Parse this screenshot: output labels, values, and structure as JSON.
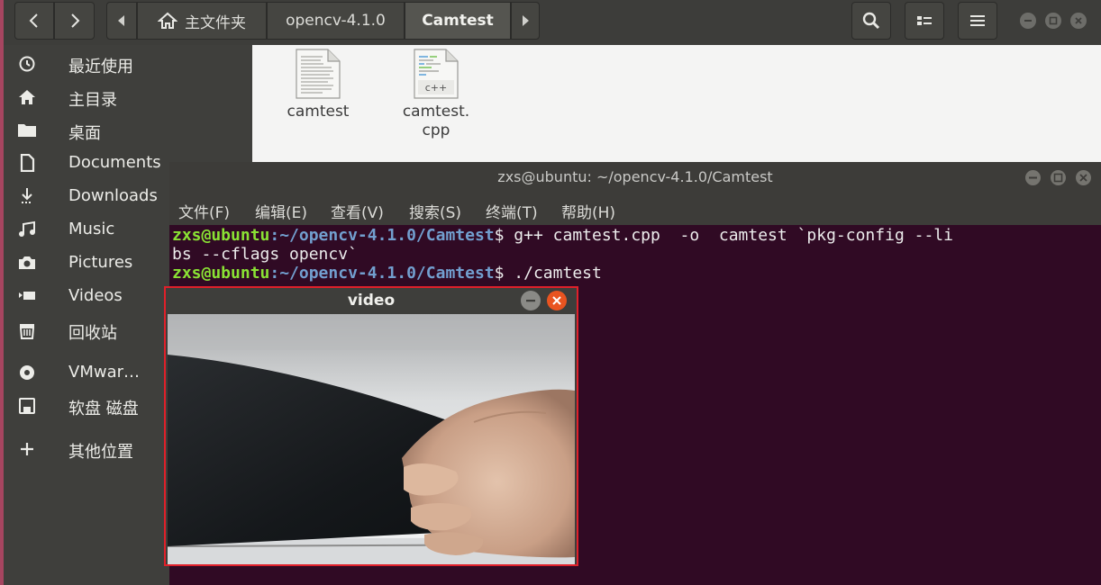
{
  "file_manager": {
    "breadcrumb": [
      "主文件夹",
      "opencv-4.1.0",
      "Camtest"
    ],
    "sidebar": [
      {
        "label": "最近使用",
        "icon": "clock-icon"
      },
      {
        "label": "主目录",
        "icon": "home-icon"
      },
      {
        "label": "桌面",
        "icon": "folder-icon"
      },
      {
        "label": "Documents",
        "icon": "document-icon"
      },
      {
        "label": "Downloads",
        "icon": "download-icon"
      },
      {
        "label": "Music",
        "icon": "music-icon"
      },
      {
        "label": "Pictures",
        "icon": "camera-icon"
      },
      {
        "label": "Videos",
        "icon": "video-icon"
      },
      {
        "label": "回收站",
        "icon": "trash-icon"
      },
      {
        "label": "VMwar…",
        "icon": "disc-icon"
      },
      {
        "label": "软盘 磁盘",
        "icon": "floppy-icon"
      },
      {
        "label": "其他位置",
        "icon": "plus-icon"
      }
    ],
    "files": [
      {
        "name": "camtest",
        "icon": "text-file-icon"
      },
      {
        "name": "camtest.\ncpp",
        "icon": "cpp-file-icon",
        "badge": "c++"
      }
    ]
  },
  "terminal": {
    "title": "zxs@ubuntu: ~/opencv-4.1.0/Camtest",
    "menu": [
      "文件(F)",
      "编辑(E)",
      "查看(V)",
      "搜索(S)",
      "终端(T)",
      "帮助(H)"
    ],
    "lines": [
      {
        "user": "zxs@ubuntu",
        "path": ":~/opencv-4.1.0/Camtest",
        "cmd": "$ g++ camtest.cpp  -o  camtest `pkg-config --li"
      },
      {
        "text": "bs --cflags opencv`"
      },
      {
        "user": "zxs@ubuntu",
        "path": ":~/opencv-4.1.0/Camtest",
        "cmd": "$ ./camtest"
      }
    ]
  },
  "video_window": {
    "title": "video"
  },
  "colors": {
    "terminal_bg": "#300a24",
    "prompt_user": "#8ae234",
    "prompt_path": "#729fcf",
    "highlight_border": "#e0202a",
    "close_button": "#e95420"
  }
}
